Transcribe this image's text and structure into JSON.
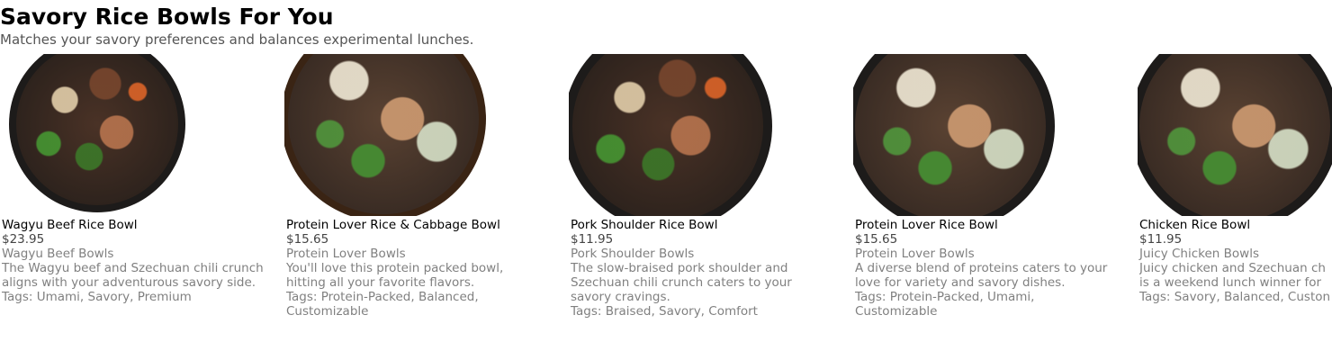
{
  "header": {
    "title": "Savory Rice Bowls For You",
    "subtitle": "Matches your savory preferences and balances experimental lunches."
  },
  "items": [
    {
      "name": "Wagyu Beef Rice Bowl",
      "price": "$23.95",
      "category": "Wagyu Beef Bowls",
      "description": "The Wagyu beef and Szechuan chili crunch aligns with your adventurous savory side.",
      "tags": "Tags: Umami, Savory, Premium",
      "image": "wagyu-beef-rice-bowl-photo"
    },
    {
      "name": "Protein Lover Rice & Cabbage Bowl",
      "price": "$15.65",
      "category": "Protein Lover Bowls",
      "description": "You'll love this protein packed bowl, hitting all your favorite flavors.",
      "tags": "Tags: Protein-Packed, Balanced, Customizable",
      "image": "protein-lover-rice-cabbage-bowl-photo"
    },
    {
      "name": "Pork Shoulder Rice Bowl",
      "price": "$11.95",
      "category": "Pork Shoulder Bowls",
      "description": "The slow-braised pork shoulder and Szechuan chili crunch caters to your savory cravings.",
      "tags": "Tags: Braised, Savory, Comfort",
      "image": "pork-shoulder-rice-bowl-photo"
    },
    {
      "name": "Protein Lover Rice Bowl",
      "price": "$15.65",
      "category": "Protein Lover Bowls",
      "description": "A diverse blend of proteins caters to your love for variety and savory dishes.",
      "tags": "Tags: Protein-Packed, Umami, Customizable",
      "image": "protein-lover-rice-bowl-photo"
    },
    {
      "name": "Chicken Rice Bowl",
      "price": "$11.95",
      "category": "Juicy Chicken Bowls",
      "description": "Juicy chicken and Szechuan ch",
      "description_line2": "is a weekend lunch winner for",
      "tags": "Tags: Savory, Balanced, Custon",
      "image": "chicken-rice-bowl-photo"
    }
  ]
}
